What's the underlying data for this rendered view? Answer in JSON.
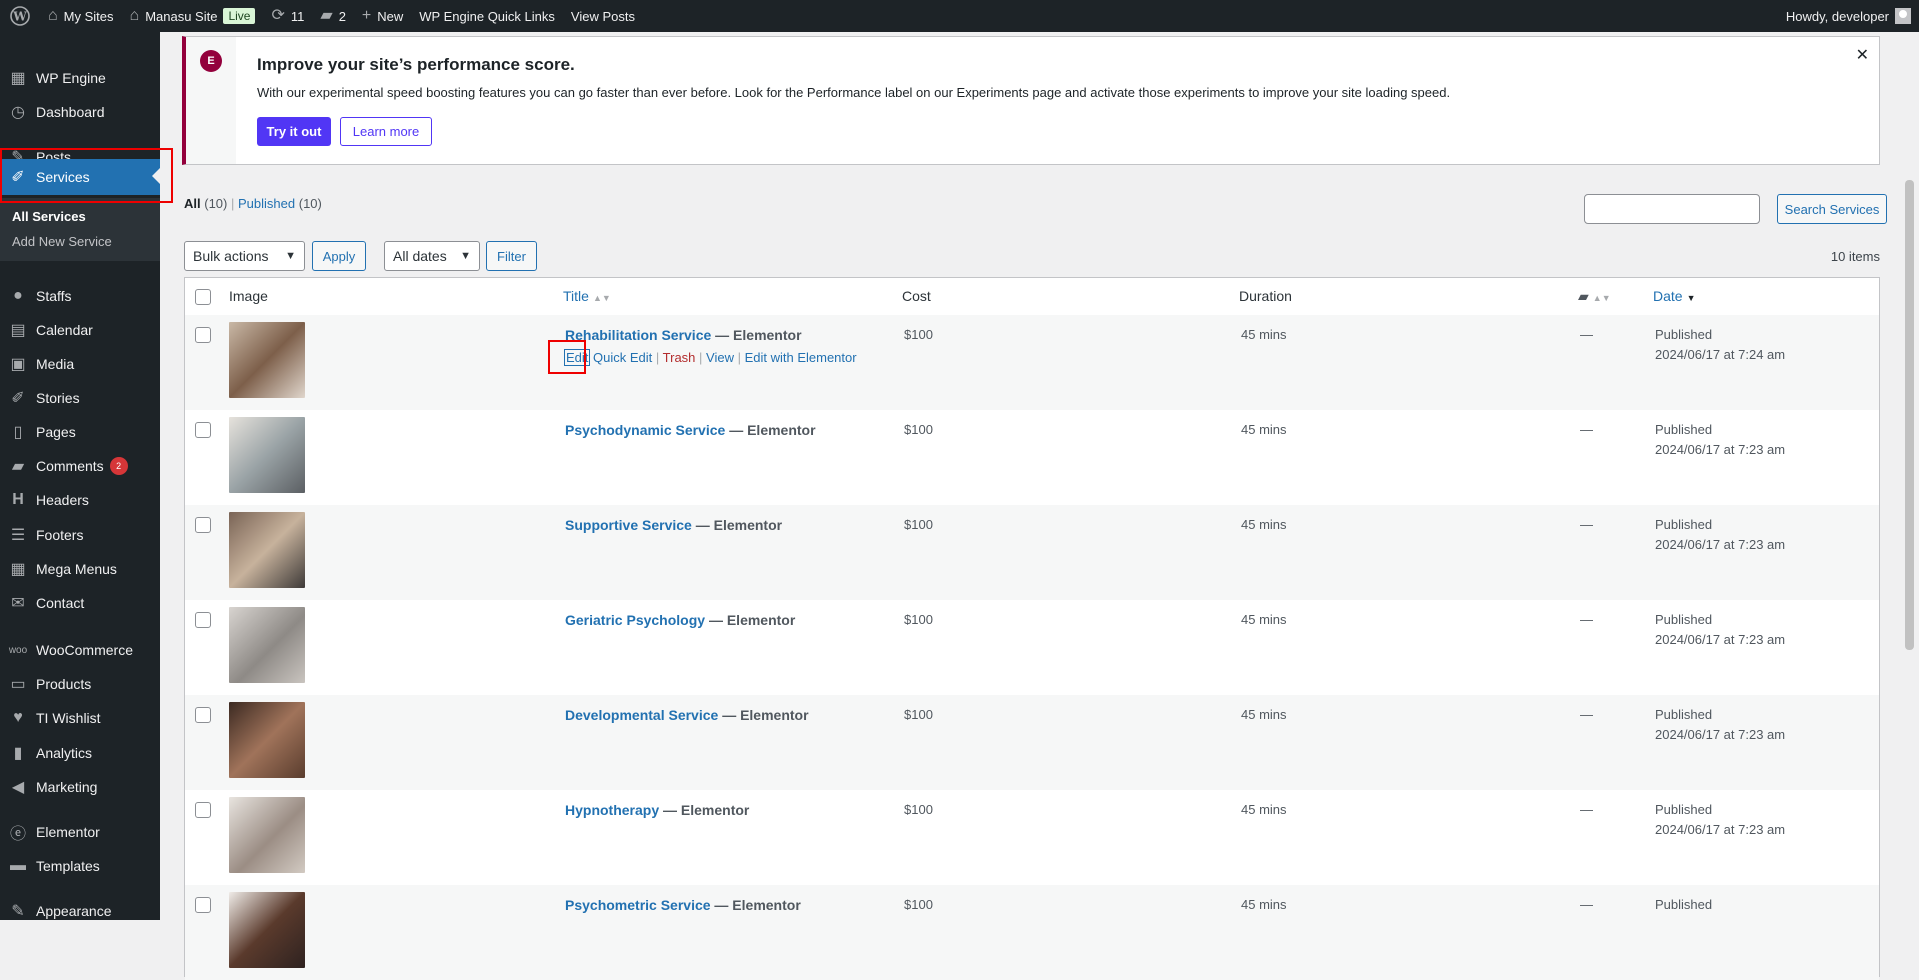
{
  "adminbar": {
    "my_sites": "My Sites",
    "site_name": "Manasu Site",
    "live_badge": "Live",
    "updates_count": "11",
    "comments_count": "2",
    "new_label": "New",
    "quick_links": "WP Engine Quick Links",
    "view_posts": "View Posts",
    "howdy": "Howdy, developer"
  },
  "sidebar": {
    "items": [
      {
        "label": "WP Engine",
        "icon": "grid-icon"
      },
      {
        "label": "Dashboard",
        "icon": "dashboard-icon"
      },
      {
        "label": "Posts",
        "icon": "pin-icon"
      },
      {
        "label": "Services",
        "icon": "carrot-icon"
      },
      {
        "label": "Staffs",
        "icon": "user-icon"
      },
      {
        "label": "Calendar",
        "icon": "calendar-icon"
      },
      {
        "label": "Media",
        "icon": "media-icon"
      },
      {
        "label": "Stories",
        "icon": "carrot-icon"
      },
      {
        "label": "Pages",
        "icon": "page-icon"
      },
      {
        "label": "Comments",
        "icon": "comment-icon",
        "badge": "2"
      },
      {
        "label": "Headers",
        "icon": "header-icon"
      },
      {
        "label": "Footers",
        "icon": "footer-icon"
      },
      {
        "label": "Mega Menus",
        "icon": "table-icon"
      },
      {
        "label": "Contact",
        "icon": "mail-icon"
      },
      {
        "label": "WooCommerce",
        "icon": "woo-icon"
      },
      {
        "label": "Products",
        "icon": "archive-icon"
      },
      {
        "label": "TI Wishlist",
        "icon": "heart-icon"
      },
      {
        "label": "Analytics",
        "icon": "bar-chart-icon"
      },
      {
        "label": "Marketing",
        "icon": "megaphone-icon"
      },
      {
        "label": "Elementor",
        "icon": "elementor-icon"
      },
      {
        "label": "Templates",
        "icon": "folder-icon"
      },
      {
        "label": "Appearance",
        "icon": "brush-icon"
      }
    ],
    "submenu": {
      "all_services": "All Services",
      "add_new": "Add New Service"
    }
  },
  "notice": {
    "title": "Improve your site’s performance score.",
    "text": "With our experimental speed boosting features you can go faster than ever before. Look for the Performance label on our Experiments page and activate those experiments to improve your site loading speed.",
    "try_label": "Try it out",
    "learn_label": "Learn more",
    "close_icon": "close-icon"
  },
  "filters": {
    "all_label": "All",
    "all_count": "(10)",
    "published_label": "Published",
    "published_count": "(10)",
    "search_button": "Search Services",
    "search_value": ""
  },
  "tablenav": {
    "bulk_actions": "Bulk actions",
    "apply": "Apply",
    "all_dates": "All dates",
    "filter": "Filter",
    "items_count": "10 items"
  },
  "table": {
    "headers": {
      "image": "Image",
      "title": "Title",
      "cost": "Cost",
      "duration": "Duration",
      "date": "Date"
    },
    "row_actions": {
      "edit": "Edit",
      "quick_edit": "Quick Edit",
      "trash": "Trash",
      "view": "View",
      "edit_elementor": "Edit with Elementor"
    },
    "rows": [
      {
        "title": "Rehabilitation Service",
        "state": "— Elementor",
        "cost": "$100",
        "duration": "45 mins",
        "comments": "—",
        "status": "Published",
        "date": "2024/06/17 at 7:24 am"
      },
      {
        "title": "Psychodynamic Service",
        "state": "— Elementor",
        "cost": "$100",
        "duration": "45 mins",
        "comments": "—",
        "status": "Published",
        "date": "2024/06/17 at 7:23 am"
      },
      {
        "title": "Supportive Service",
        "state": "— Elementor",
        "cost": "$100",
        "duration": "45 mins",
        "comments": "—",
        "status": "Published",
        "date": "2024/06/17 at 7:23 am"
      },
      {
        "title": "Geriatric Psychology",
        "state": "— Elementor",
        "cost": "$100",
        "duration": "45 mins",
        "comments": "—",
        "status": "Published",
        "date": "2024/06/17 at 7:23 am"
      },
      {
        "title": "Developmental Service",
        "state": "— Elementor",
        "cost": "$100",
        "duration": "45 mins",
        "comments": "—",
        "status": "Published",
        "date": "2024/06/17 at 7:23 am"
      },
      {
        "title": "Hypnotherapy",
        "state": "— Elementor",
        "cost": "$100",
        "duration": "45 mins",
        "comments": "—",
        "status": "Published",
        "date": "2024/06/17 at 7:23 am"
      },
      {
        "title": "Psychometric Service",
        "state": "— Elementor",
        "cost": "$100",
        "duration": "45 mins",
        "comments": "—",
        "status": "Published",
        "date": ""
      }
    ]
  }
}
